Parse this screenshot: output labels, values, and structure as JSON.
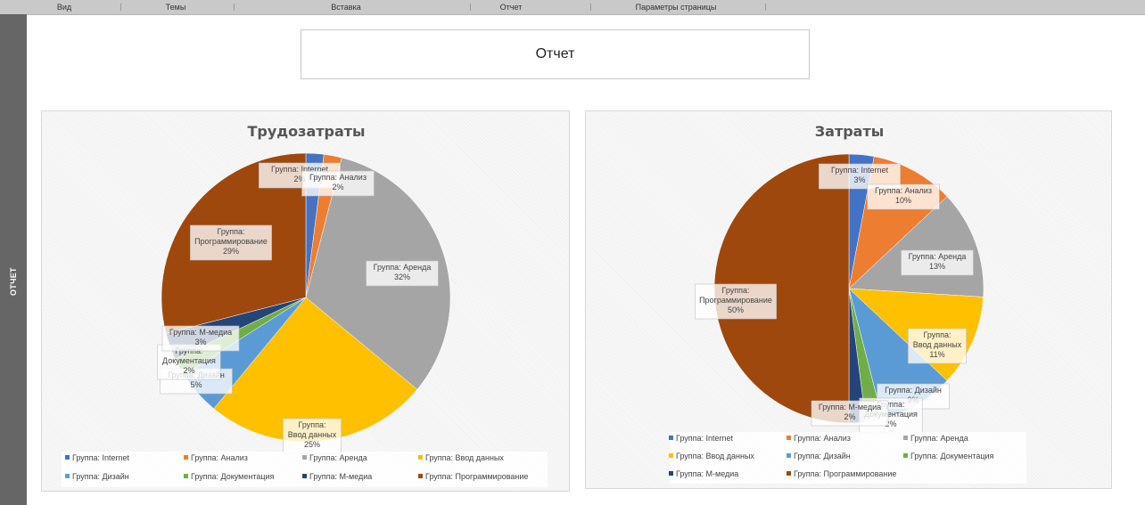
{
  "ribbon": {
    "tabs": [
      "Вид",
      "Темы",
      "Вставка",
      "Отчет",
      "Параметры страницы"
    ]
  },
  "sidebar": {
    "label": "ОТЧЕТ"
  },
  "report": {
    "title": "Отчет"
  },
  "charts": {
    "colors": [
      "#4472c4",
      "#ed7d31",
      "#a5a5a5",
      "#ffc000",
      "#5b9bd5",
      "#70ad47",
      "#264478",
      "#9e480e"
    ]
  },
  "chart_data": [
    {
      "type": "pie",
      "title": "Трудозатраты",
      "categories": [
        "Группа: Internet",
        "Группа: Анализ",
        "Группа: Аренда",
        "Группа: Ввод данных",
        "Группа: Дизайн",
        "Группа: Документация",
        "Группа: М-медиа",
        "Группа: Программирование"
      ],
      "values": [
        2,
        2,
        32,
        25,
        5,
        2,
        3,
        29
      ],
      "value_format": "percent",
      "legend": "bottom"
    },
    {
      "type": "pie",
      "title": "Затраты",
      "categories": [
        "Группа: Internet",
        "Группа: Анализ",
        "Группа: Аренда",
        "Группа: Ввод данных",
        "Группа: Дизайн",
        "Группа: Документация",
        "Группа: М-медиа",
        "Группа: Программирование"
      ],
      "values": [
        3,
        10,
        13,
        11,
        9,
        2,
        2,
        50
      ],
      "value_format": "percent",
      "legend": "bottom"
    }
  ]
}
